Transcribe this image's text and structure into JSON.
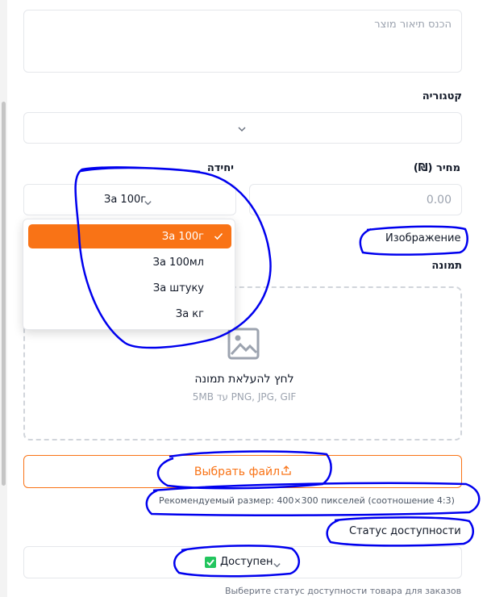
{
  "description_field": {
    "placeholder": "הכנס תיאור מוצר"
  },
  "category": {
    "label": "קטגוריה",
    "value": ""
  },
  "price": {
    "label": "מחיר (₪)",
    "placeholder": "0.00"
  },
  "unit": {
    "label": "יחידה",
    "selected": "За 100г",
    "options": [
      {
        "label": "За 100г",
        "selected": true
      },
      {
        "label": "За 100мл",
        "selected": false
      },
      {
        "label": "За штуку",
        "selected": false
      },
      {
        "label": "За кг",
        "selected": false
      }
    ]
  },
  "image_section": {
    "heading": "Изображение",
    "label": "תמונה",
    "upload_prompt": "לחץ להעלאת תמונה",
    "upload_formats": "PNG, JPG, GIF עד 5MB",
    "choose_file_button": "Выбрать файл",
    "recommended_size": "Рекомендуемый размер: 400×300 пикселей (соотношение 4:3)"
  },
  "availability": {
    "heading": "Статус доступности",
    "value": "Доступен",
    "hint": "Выберите статус доступности товара для заказов"
  },
  "colors": {
    "accent": "#f97316",
    "annotation": "#0000ee",
    "check_green": "#22c55e"
  }
}
